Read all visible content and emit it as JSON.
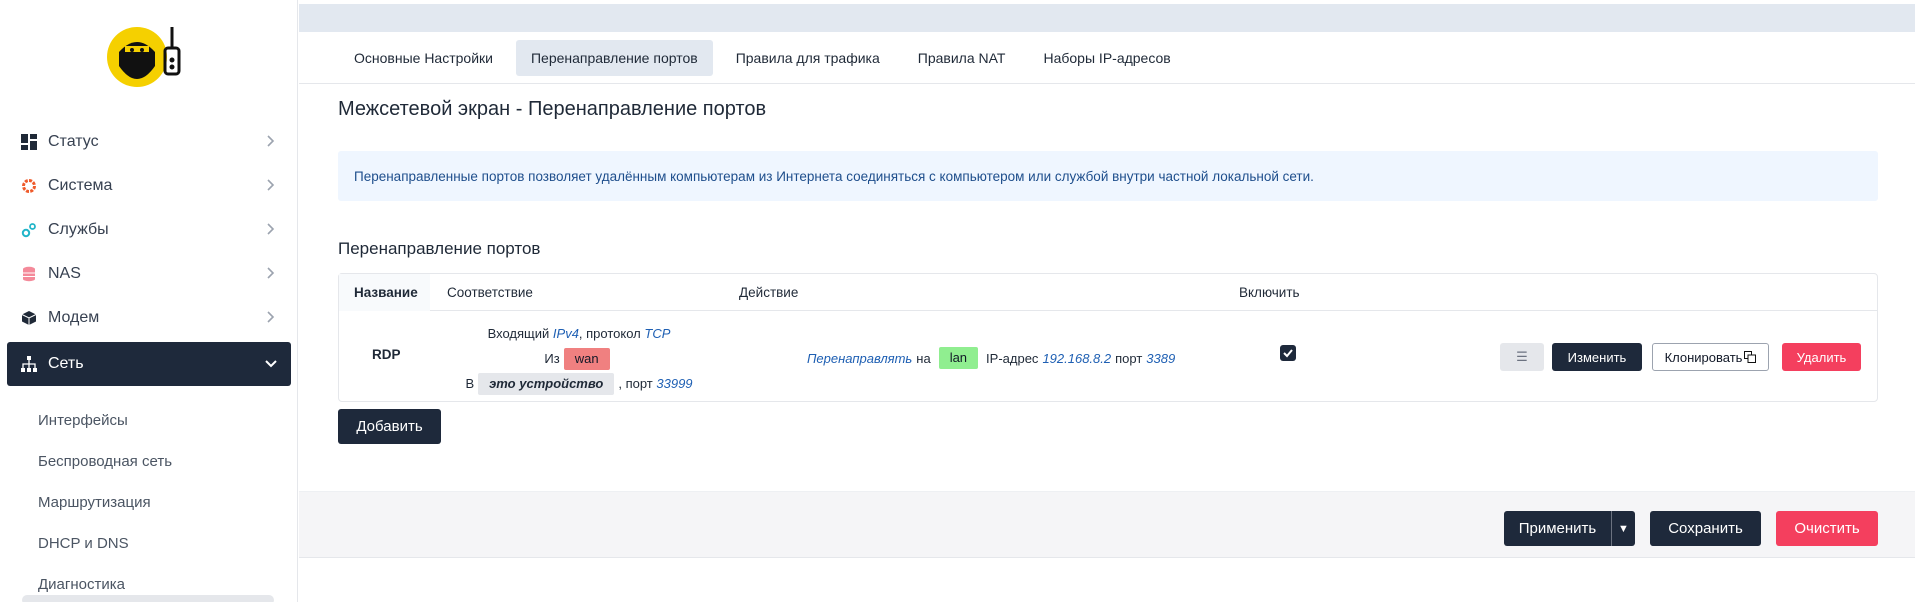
{
  "sidebar": {
    "items": [
      {
        "label": "Статус",
        "icon": "dashboard-icon"
      },
      {
        "label": "Система",
        "icon": "gear-icon"
      },
      {
        "label": "Службы",
        "icon": "cogs-icon"
      },
      {
        "label": "NAS",
        "icon": "database-icon"
      },
      {
        "label": "Модем",
        "icon": "cube-icon"
      },
      {
        "label": "Сеть",
        "icon": "network-icon"
      }
    ],
    "sub_items": [
      "Интерфейсы",
      "Беспроводная сеть",
      "Маршрутизация",
      "DHCP и DNS",
      "Диагностика"
    ]
  },
  "tabs": [
    {
      "label": "Основные Настройки",
      "active": false
    },
    {
      "label": "Перенаправление портов",
      "active": true
    },
    {
      "label": "Правила для трафика",
      "active": false
    },
    {
      "label": "Правила NAT",
      "active": false
    },
    {
      "label": "Наборы IP-адресов",
      "active": false
    }
  ],
  "page": {
    "title": "Межсетевой экран - Перенаправление портов",
    "info": "Перенаправленные портов позволяет удалённым компьютерам из Интернета соединяться с компьютером или службой внутри частной локальной сети.",
    "section_title": "Перенаправление портов"
  },
  "table": {
    "headers": {
      "name": "Название",
      "match": "Соответствие",
      "action": "Действие",
      "enable": "Включить"
    },
    "rows": [
      {
        "name": "RDP",
        "match": {
          "incoming": "Входящий",
          "family": "IPv4",
          "protocol_label": ", протокол",
          "protocol": "TCP",
          "from_label": "Из",
          "from_zone": "wan",
          "in_label": "В",
          "device": "это устройство",
          "port_label": ", порт",
          "port": "33999"
        },
        "action": {
          "verb": "Перенаправлять",
          "on_label": "на",
          "zone": "lan",
          "ip_label": "IP-адрес",
          "ip": "192.168.8.2",
          "port_label": "порт",
          "port": "3389"
        },
        "enabled": true,
        "buttons": {
          "drag": "☰",
          "edit": "Изменить",
          "clone": "Клонировать",
          "delete": "Удалить"
        }
      }
    ]
  },
  "add_label": "Добавить",
  "footer": {
    "apply": "Применить",
    "apply_dropdown": "▼",
    "save": "Сохранить",
    "reset": "Очистить"
  },
  "colors": {
    "primary": "#1e293b",
    "danger": "#f43f5e",
    "wan": "#f08080",
    "lan": "#90ee90",
    "logo": "#f5d000"
  }
}
